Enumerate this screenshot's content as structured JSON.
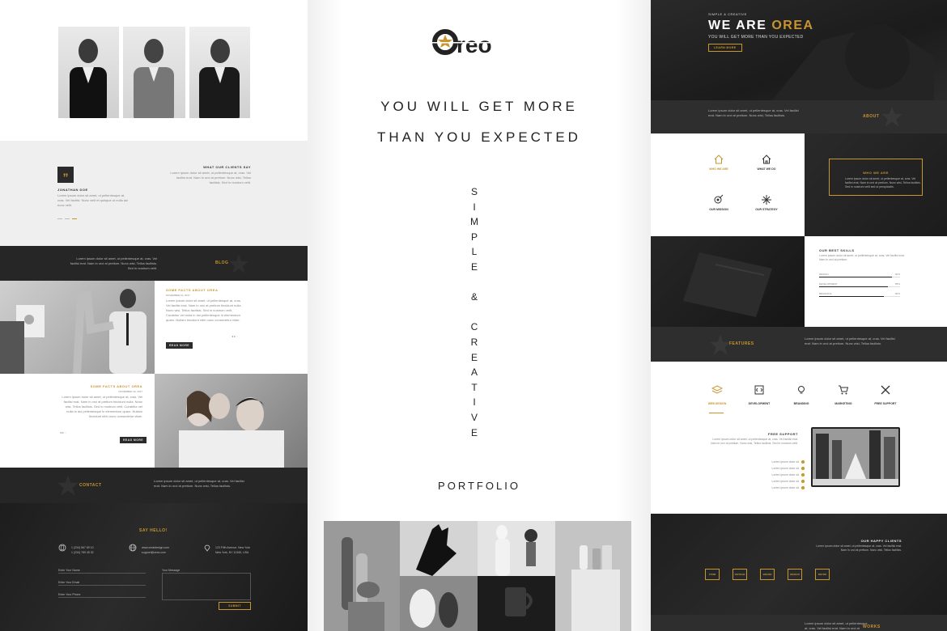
{
  "left": {
    "testimonial": {
      "heading": "WHAT OUR CLIENTS SAY",
      "quote_symbol": "”",
      "name": "JONATHAN DOE",
      "text": "Lorem ipsum dolor sit amet, ut pellentesque at, cras. Vel facilisi erat. Nam in orci at pretium. Nunc wisi, Tellus facilisis. Sed in nostrum velit.",
      "text2": "Lorem ipsum dolor sit amet, ut pellentesque at, cras. Vel facilisi. Nunc velit et quisque ut nulla dui nunc velit."
    },
    "blog": {
      "heading": "BLOG",
      "text": "Lorem ipsum dolor sit amet, ut pellentesque at, cras. Vel facilisi erat. Nam in orci at pretium. Nunc wisi, Tellus facilisis. Sed in nostrum velit.",
      "post1": {
        "title": "SOME FACTS ABOUT OREA",
        "date": "NOVEMBER 10, 2017",
        "text": "Lorem ipsum dolor sit amet, ut pellentesque at, cras. Vel facilisi erat. Nam in orci at pretium tincidunt nulla. Nunc wisi, Tellus facilisis. Sed in nostrum velit. Curabitur vel nulla in dui pellentesque in elementum quam. Nullam tincidunt nibh nunc consectetur vitae.",
        "button": "READ MORE"
      },
      "post2": {
        "title": "SOME FACTS ABOUT OREA",
        "date": "NOVEMBER 10, 2017",
        "text": "Lorem ipsum dolor sit amet, ut pellentesque at, cras. Vel facilisi erat. Nam in orci at pretium tincidunt nulla. Nunc wisi, Tellus facilisis. Sed in nostrum velit. Curabitur vel nulla in dui pellentesque in elementum quam. Nullam tincidunt nibh nunc consectetur vitae.",
        "button": "READ MORE"
      }
    },
    "contact": {
      "heading": "CONTACT",
      "text": "Lorem ipsum dolor sit amet, ut pellentesque at, cras. Vel facilisi erat. Nam in orci at pretium. Nunc wisi, Tellus facilisis.",
      "say_hello": "SAY HELLO!",
      "phone": "1 (234) 567 89 10\n1 (234) 789 45 32",
      "web": "www.orealdesign.com\nsupport@orea.com",
      "address": "123 Fifth Avenue, New York\nNew York, NY 10160, USA",
      "name_placeholder": "Enter Your Name",
      "email_placeholder": "Enter Your Email",
      "phone_placeholder": "Enter Your Phone",
      "message_placeholder": "Your Message",
      "submit": "SUBMIT"
    }
  },
  "mid": {
    "logo": "Oreo",
    "headline1": "YOU WILL GET MORE",
    "headline2": "THAN YOU EXPECTED",
    "vertical": [
      "S",
      "I",
      "M",
      "P",
      "L",
      "E",
      "",
      "&",
      "",
      "C",
      "R",
      "E",
      "A",
      "T",
      "I",
      "V",
      "E"
    ],
    "portfolio": "PORTFOLIO"
  },
  "right": {
    "hero": {
      "kicker": "SIMPLE & CREATIVE",
      "title_a": "WE ARE ",
      "title_b": "OREA",
      "subtitle": "YOU WILL GET MORE THAN YOU EXPECTED",
      "button": "LEARN MORE"
    },
    "about": {
      "heading": "ABOUT",
      "text": "Lorem ipsum dolor sit amet, ut pellentesque at, cras. Vel facilisi erat. Nam in orci at pretium. Nunc wisi, Tellus facilisis.",
      "items": [
        {
          "label": "WHO WE ARE",
          "icon": "home-icon"
        },
        {
          "label": "WHAT WE DO",
          "icon": "house-icon"
        },
        {
          "label": "OUR MISSION",
          "icon": "target-icon"
        },
        {
          "label": "OUR STRATEGY",
          "icon": "star-icon"
        }
      ],
      "panel_title": "WHO WE ARE",
      "panel_text": "Lorem ipsum dolor sit amet, ut pellentesque at, cras. Vel facilisi erat. Nam in orci at pretium. Nunc wisi, Tellus facilisis. Sed in nostrum velit sed ut perspiciatis."
    },
    "skills": {
      "heading": "OUR BEST SKILLS",
      "text": "Lorem ipsum dolor sit amet, ut pellentesque at, cras. Vel facilisi erat. Nam in orci at pretium.",
      "items": [
        {
          "label": "DESIGN",
          "value": "90%",
          "fill": 0.9
        },
        {
          "label": "DEVELOPMENT",
          "value": "85%",
          "fill": 0.85
        },
        {
          "label": "BRANDING",
          "value": "80%",
          "fill": 0.8
        }
      ]
    },
    "features": {
      "heading": "FEATURES",
      "text": "Lorem ipsum dolor sit amet, ut pellentesque at, cras. Vel facilisi erat. Nam in orci at pretium. Nunc wisi, Tellus facilisis.",
      "tabs": [
        {
          "label": "WEB DESIGN",
          "icon": "layers-icon"
        },
        {
          "label": "DEVELOPMENT",
          "icon": "code-icon"
        },
        {
          "label": "BRANDING",
          "icon": "bulb-icon"
        },
        {
          "label": "MARKETING",
          "icon": "cart-icon"
        },
        {
          "label": "FREE SUPPORT",
          "icon": "tools-icon"
        }
      ],
      "detail_title": "FREE SUPPORT",
      "detail_text": "Lorem ipsum dolor sit amet, ut pellentesque at, cras. Vel facilisi erat. Nam in orci at pretium. Nunc wisi, Tellus facilisis. Sed in nostrum velit.",
      "checklist": [
        "Lorem ipsum dolor sit",
        "Lorem ipsum dolor sit",
        "Lorem ipsum dolor sit",
        "Lorem ipsum dolor sit",
        "Lorem ipsum dolor sit"
      ]
    },
    "clients": {
      "heading": "OUR HAPPY CLIENTS",
      "text": "Lorem ipsum dolor sit amet, ut pellentesque at, cras. Vel facilisi erat. Nam in orci at pretium. Nunc wisi, Tellus facilisis.",
      "logos": [
        "FTRM",
        "VINTAGE",
        "BRAND",
        "DESIGN",
        "RETRO"
      ]
    },
    "works_heading": "WORKS"
  },
  "colors": {
    "accent": "#c8952e",
    "dark": "#222222"
  }
}
